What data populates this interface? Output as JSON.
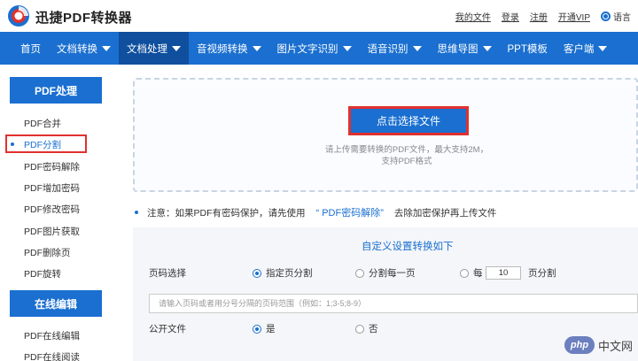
{
  "app": {
    "title": "迅捷PDF转换器"
  },
  "toplinks": {
    "my_files": "我的文件",
    "login": "登录",
    "register": "注册",
    "vip": "开通VIP",
    "language": "语言"
  },
  "nav": [
    {
      "label": "首页",
      "dropdown": false,
      "active": false
    },
    {
      "label": "文档转换",
      "dropdown": true,
      "active": false
    },
    {
      "label": "文档处理",
      "dropdown": true,
      "active": true
    },
    {
      "label": "音视频转换",
      "dropdown": true,
      "active": false
    },
    {
      "label": "图片文字识别",
      "dropdown": true,
      "active": false
    },
    {
      "label": "语音识别",
      "dropdown": true,
      "active": false
    },
    {
      "label": "思维导图",
      "dropdown": true,
      "active": false
    },
    {
      "label": "PPT模板",
      "dropdown": false,
      "active": false
    },
    {
      "label": "客户端",
      "dropdown": true,
      "active": false
    }
  ],
  "sidebar": {
    "section1_title": "PDF处理",
    "section1_items": [
      "PDF合并",
      "PDF分割",
      "PDF密码解除",
      "PDF增加密码",
      "PDF修改密码",
      "PDF图片获取",
      "PDF删除页",
      "PDF旋转"
    ],
    "active_item": "PDF分割",
    "section2_title": "在线编辑",
    "section2_items": [
      "PDF在线编辑",
      "PDF在线阅读"
    ]
  },
  "upload": {
    "button_label": "点击选择文件",
    "hint_line1": "请上传需要转换的PDF文件，最大支持2M，",
    "hint_line2": "支持PDF格式"
  },
  "notice": {
    "prefix": "注意：如果PDF有密码保护，请先使用",
    "link": "“ PDF密码解除”",
    "suffix": "去除加密保护再上传文件"
  },
  "settings": {
    "title": "自定义设置转换如下",
    "page_select_label": "页码选择",
    "option_specified": "指定页分割",
    "option_each": "分割每一页",
    "option_every_prefix": "每",
    "every_value": "10",
    "option_every_suffix": "页分割",
    "range_placeholder": "请输入页码或者用分号分隔的页码范围（例如：1;3-5;8-9）",
    "public_label": "公开文件",
    "public_yes": "是",
    "public_no": "否"
  },
  "watermark": {
    "logo": "php",
    "text": "中文网"
  },
  "colors": {
    "brand_blue": "#1a6fd0",
    "nav_active": "#0f4f9e",
    "highlight_red": "#e0312f"
  },
  "icons": {
    "logo": "app-logo-icon",
    "language": "globe-icon",
    "dropdown": "caret-down-icon"
  }
}
